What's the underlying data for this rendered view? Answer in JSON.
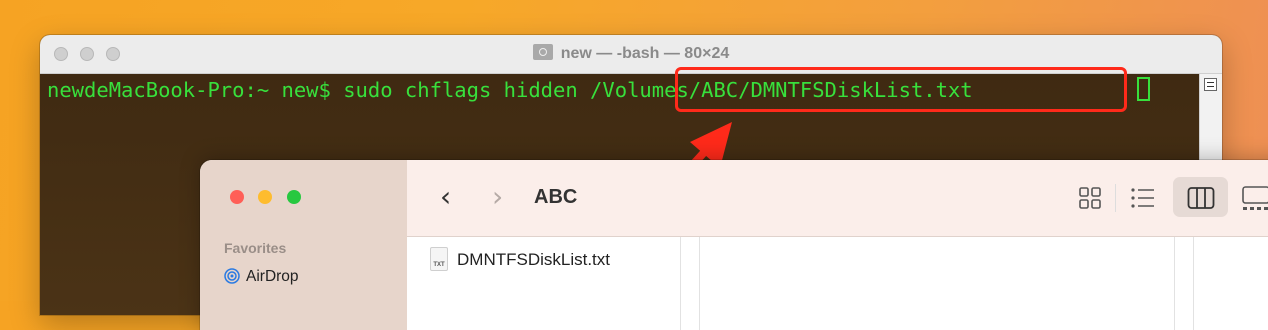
{
  "terminal": {
    "title": "new — -bash — 80×24",
    "command_line": "newdeMacBook-Pro:~ new$ sudo chflags hidden /Volumes/ABC/DMNTFSDiskList.txt"
  },
  "finder": {
    "folder_title": "ABC",
    "sidebar": {
      "section": "Favorites",
      "items": [
        {
          "label": "AirDrop"
        }
      ]
    },
    "files": [
      {
        "name": "DMNTFSDiskList.txt",
        "icon_text": "TXT"
      }
    ]
  },
  "colors": {
    "terminal_text": "#38e03c",
    "terminal_bg": "#463014",
    "highlight": "#ff2a1a",
    "close": "#ff5f57",
    "minimize": "#febc2e",
    "zoom": "#28c840"
  }
}
